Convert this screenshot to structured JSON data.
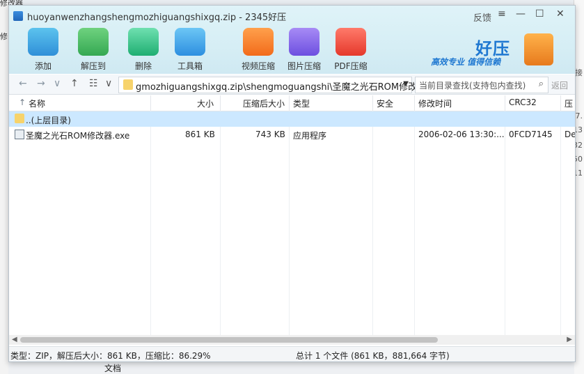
{
  "window": {
    "title": "huoyanwenzhangshengmozhiguangshixgq.zip - 2345好压",
    "feedback": "反馈",
    "min": "—",
    "max": "☐",
    "close": "✕"
  },
  "toolbar": {
    "add": "添加",
    "extract": "解压到",
    "delete": "删除",
    "toolbox": "工具箱",
    "video": "视频压缩",
    "image": "图片压缩",
    "pdf": "PDF压缩"
  },
  "brand": {
    "name": "好压",
    "slogan": "高效专业 值得信赖"
  },
  "nav": {
    "back": "←",
    "forward": "→",
    "dropdown": "∨",
    "up": "↑",
    "view": "☷",
    "path": "gmozhiguangshixgq.zip\\shengmoguangshi\\圣魔之光石ROM修改器",
    "path_caret": "▼",
    "search_placeholder": "当前目录查找(支持包内查找)",
    "back_label": "返回"
  },
  "columns": {
    "name": "名称",
    "size": "大小",
    "packed": "压缩后大小",
    "type": "类型",
    "security": "安全",
    "modified": "修改时间",
    "crc": "CRC32",
    "ratio": "压"
  },
  "rows": [
    {
      "name": "..(上层目录)",
      "size": "",
      "packed": "",
      "type": "",
      "modified": "",
      "crc": ""
    },
    {
      "name": "圣魔之光石ROM修改器.exe",
      "size": "861 KB",
      "packed": "743 KB",
      "type": "应用程序",
      "modified": "2006-02-06 13:30:...",
      "crc": "0FCD7145",
      "ratio": "De"
    }
  ],
  "status": {
    "left": "类型：ZIP，解压后大小：861 KB，压缩比：86.29%",
    "right": "总计 1 个文件 (861 KB，881,664 字节)"
  },
  "background": {
    "left_texts": [
      "修改器",
      "修"
    ],
    "right_texts": [
      "7.",
      "13",
      "(32",
      "50",
      "11",
      "接"
    ],
    "bottom_text": "文档"
  }
}
